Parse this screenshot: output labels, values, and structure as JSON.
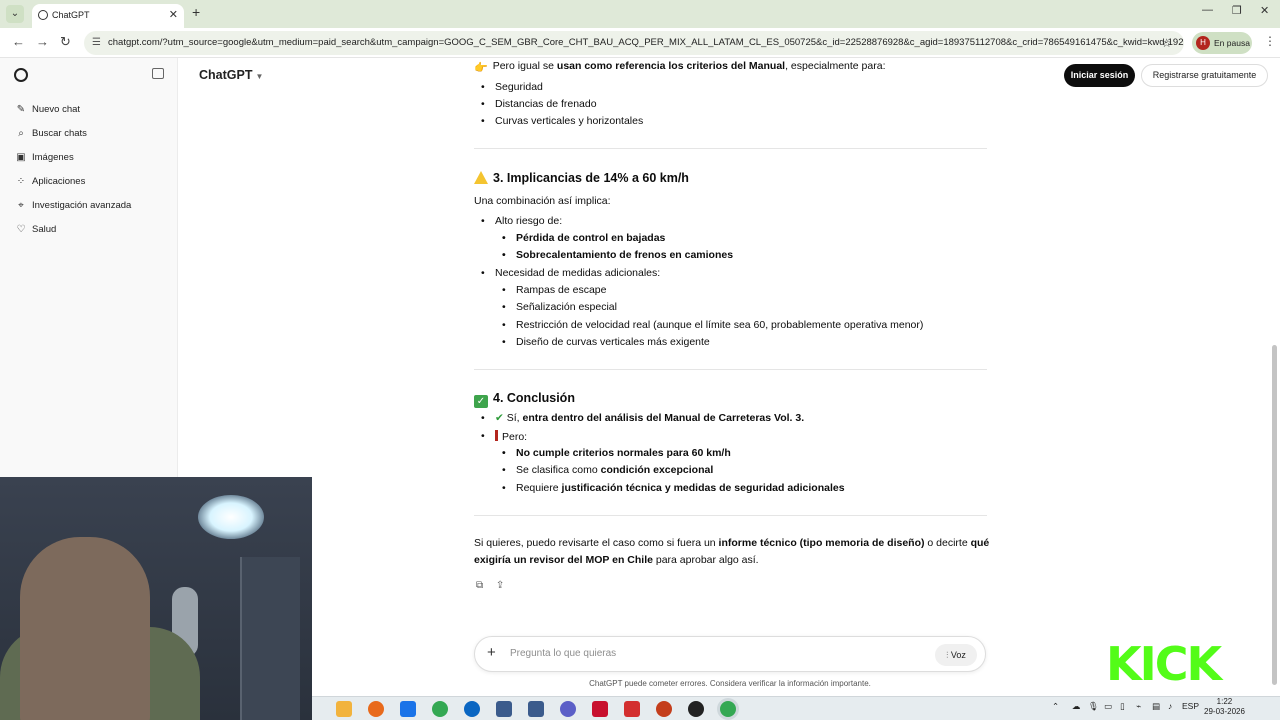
{
  "browser": {
    "tab_title": "ChatGPT",
    "url": "chatgpt.com/?utm_source=google&utm_medium=paid_search&utm_campaign=GOOG_C_SEM_GBR_Core_CHT_BAU_ACQ_PER_MIX_ALL_LATAM_CL_ES_050725&c_id=22528876928&c_agid=189375112708&c_crid=786549161475&c_kwid=kwd-1927227...",
    "profile_initial": "H",
    "profile_status": "En pausa"
  },
  "sidebar": {
    "items": [
      {
        "label": "Nuevo chat",
        "icon": "edit-icon"
      },
      {
        "label": "Buscar chats",
        "icon": "search-icon"
      },
      {
        "label": "Imágenes",
        "icon": "image-icon"
      },
      {
        "label": "Aplicaciones",
        "icon": "apps-icon"
      },
      {
        "label": "Investigación avanzada",
        "icon": "telescope-icon"
      },
      {
        "label": "Salud",
        "icon": "heart-icon"
      }
    ]
  },
  "header": {
    "title": "ChatGPT",
    "login_label": "Iniciar sesión",
    "signup_label": "Registrarse gratuitamente"
  },
  "message": {
    "intro_pre": "Pero igual se ",
    "intro_bold": "usan como referencia los criterios del Manual",
    "intro_post": ", especialmente para:",
    "intro_items": [
      "Seguridad",
      "Distancias de frenado",
      "Curvas verticales y horizontales"
    ],
    "section3_title": "3. Implicancias de 14% a 60 km/h",
    "section3_lead": "Una combinación así implica:",
    "risk_label": "Alto riesgo de:",
    "risk_items": [
      "Pérdida de control en bajadas",
      "Sobrecalentamiento de frenos en camiones"
    ],
    "measures_label": "Necesidad de medidas adicionales:",
    "measures_items": [
      "Rampas de escape",
      "Señalización especial",
      "Restricción de velocidad real (aunque el límite sea 60, probablemente operativa menor)",
      "Diseño de curvas verticales más exigente"
    ],
    "section4_title": "4. Conclusión",
    "concl_yes_pre": "Sí, ",
    "concl_yes_bold": "entra dentro del análisis del Manual de Carreteras Vol. 3.",
    "concl_but": "Pero:",
    "concl_item1": "No cumple criterios normales para 60 km/h",
    "concl_item2_pre": "Se clasifica como ",
    "concl_item2_bold": "condición excepcional",
    "concl_item3_pre": "Requiere ",
    "concl_item3_bold": "justificación técnica y medidas de seguridad adicionales",
    "outro_1": "Si quieres, puedo revisarte el caso como si fuera un ",
    "outro_bold1": "informe técnico (tipo memoria de diseño)",
    "outro_2": " o decirte ",
    "outro_bold2a": "qué",
    "outro_bold2b": "exigiría un revisor del MOP en Chile",
    "outro_3": " para aprobar algo así."
  },
  "composer": {
    "placeholder": "Pregunta lo que quieras",
    "voice_label": "Voz",
    "disclaimer": "ChatGPT puede cometer errores. Considera verificar la información importante."
  },
  "overlay": {
    "kick_logo": "KICK"
  },
  "taskbar": {
    "lang": "ESP",
    "time": "1:22",
    "date": "29-03-2026"
  }
}
